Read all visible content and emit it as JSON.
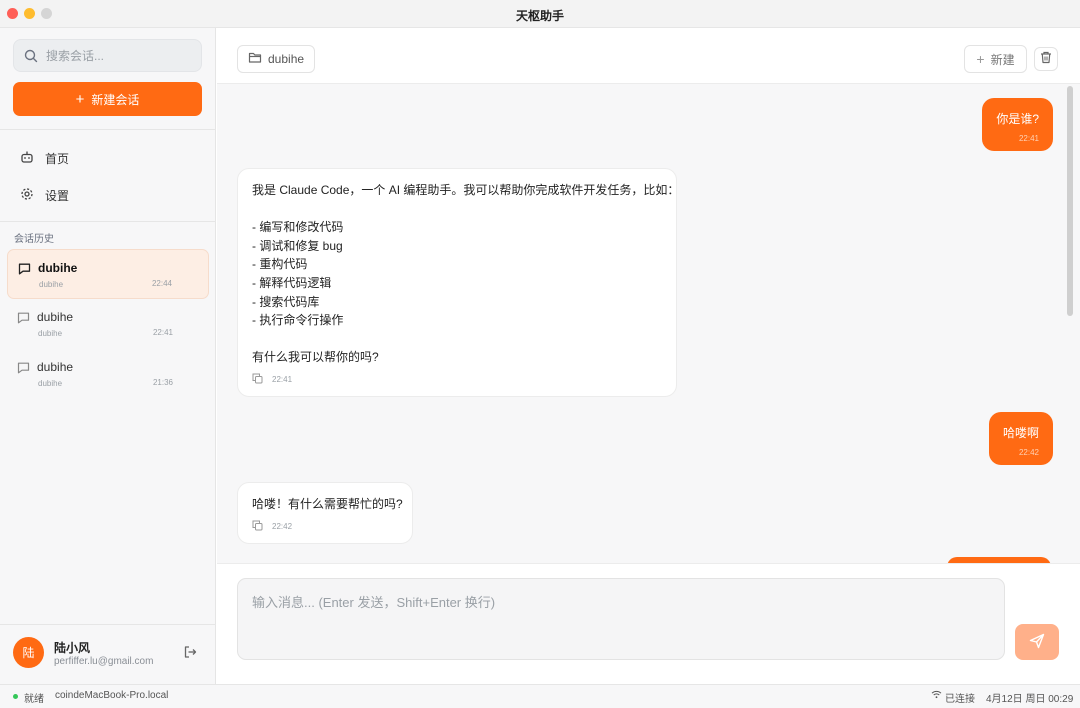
{
  "window": {
    "title": "天枢助手"
  },
  "sidebar": {
    "search_placeholder": "搜索会话...",
    "new_chat_label": "新建会话",
    "nav": [
      {
        "label": "首页",
        "icon": "robot-icon"
      },
      {
        "label": "设置",
        "icon": "gear-icon"
      }
    ],
    "history_label": "会话历史",
    "history": [
      {
        "title": "dubihe",
        "subtitle": "dubihe",
        "time": "22:44",
        "active": true
      },
      {
        "title": "dubihe",
        "subtitle": "dubihe",
        "time": "22:41",
        "active": false
      },
      {
        "title": "dubihe",
        "subtitle": "dubihe",
        "time": "21:36",
        "active": false
      }
    ],
    "user": {
      "avatar": "陆",
      "name": "陆小风",
      "email": "perfiffer.lu@gmail.com"
    }
  },
  "header": {
    "folder_label": "dubihe",
    "new_label": "新建"
  },
  "messages": [
    {
      "role": "user",
      "text": "你是谁?",
      "time": "22:41"
    },
    {
      "role": "assistant",
      "lines": [
        "我是 Claude Code，一个 AI 编程助手。我可以帮助你完成软件开发任务，比如：",
        "",
        "- 编写和修改代码",
        "- 调试和修复 bug",
        "- 重构代码",
        "- 解释代码逻辑",
        "- 搜索代码库",
        "- 执行命令行操作",
        "",
        "有什么我可以帮你的吗?"
      ],
      "time": "22:41"
    },
    {
      "role": "user",
      "text": "哈喽啊",
      "time": "22:42"
    },
    {
      "role": "assistant",
      "lines": [
        "哈喽！有什么需要帮忙的吗?"
      ],
      "time": "22:42"
    }
  ],
  "composer": {
    "placeholder": "输入消息... (Enter 发送，Shift+Enter 换行)"
  },
  "statusbar": {
    "status": "就绪",
    "host": "coindeMacBook-Pro.local",
    "connection": "已连接",
    "datetime": "4月12日 周日 00:29"
  },
  "colors": {
    "accent": "#ff6a13",
    "accent_soft": "#fdeee4",
    "ready_dot": "#34c759"
  }
}
